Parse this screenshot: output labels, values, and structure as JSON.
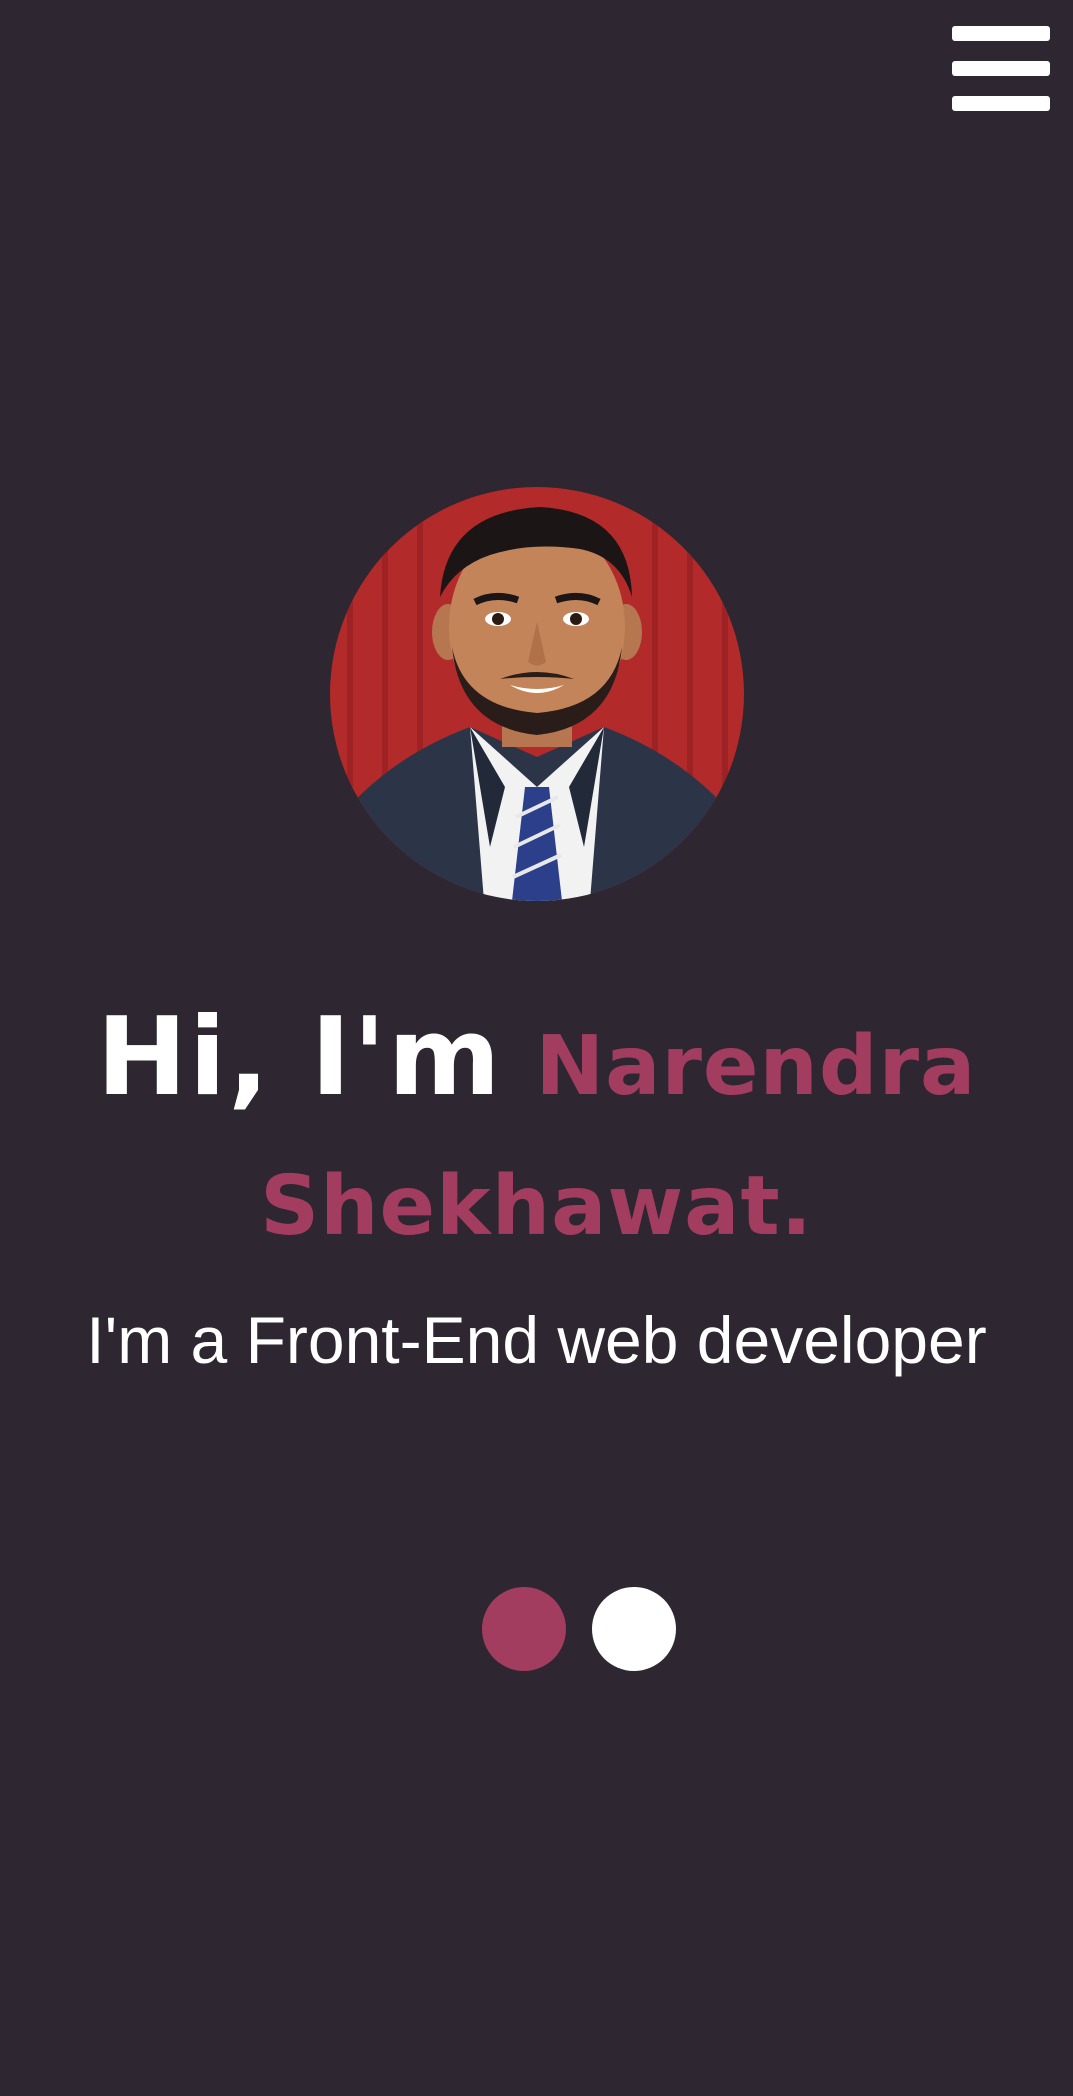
{
  "colors": {
    "background": "#2e2631",
    "accent": "#a33d60",
    "text": "#ffffff"
  },
  "header": {
    "menu_icon": "hamburger-menu-icon"
  },
  "hero": {
    "avatar_alt": "profile photo",
    "greeting": "Hi, I'm",
    "name": "Narendra Shekhawat.",
    "subtitle": "I'm a Front-End web developer"
  },
  "slider": {
    "dots": [
      {
        "state": "active",
        "color": "#a33d60"
      },
      {
        "state": "inactive",
        "color": "#ffffff"
      }
    ]
  }
}
